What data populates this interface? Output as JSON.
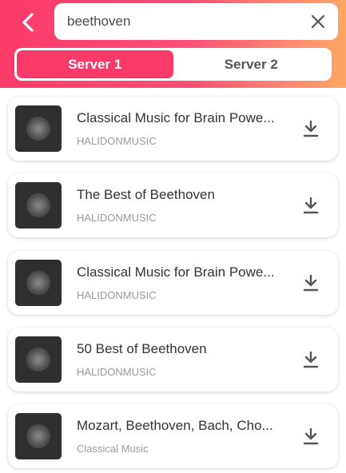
{
  "header": {
    "back_icon": "chevron-left-icon",
    "clear_icon": "close-icon"
  },
  "search": {
    "value": "beethoven"
  },
  "tabs": [
    {
      "label": "Server 1",
      "active": true
    },
    {
      "label": "Server 2",
      "active": false
    }
  ],
  "results": [
    {
      "title": "Classical Music for Brain Powe...",
      "artist": "HALIDONMUSIC"
    },
    {
      "title": "The Best of Beethoven",
      "artist": "HALIDONMUSIC"
    },
    {
      "title": "Classical Music for Brain Powe...",
      "artist": "HALIDONMUSIC"
    },
    {
      "title": "50 Best of Beethoven",
      "artist": "HALIDONMUSIC"
    },
    {
      "title": "Mozart, Beethoven, Bach, Cho...",
      "artist": "Classical Music"
    }
  ],
  "colors": {
    "accent": "#fb3a6a",
    "gradient_end": "#fea663",
    "thumbnail_bg": "#2f2f2f",
    "icon": "#555555"
  }
}
